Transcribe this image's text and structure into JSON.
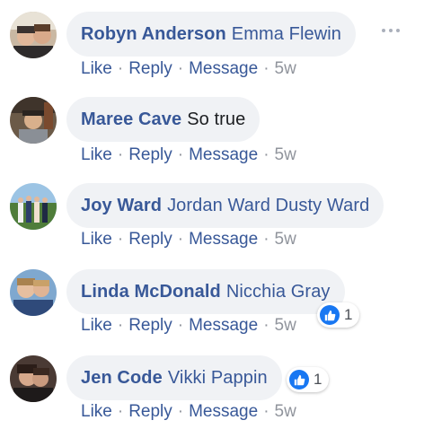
{
  "actions": {
    "like": "Like",
    "reply": "Reply",
    "message": "Message",
    "separator": "·"
  },
  "colors": {
    "author": "#385898",
    "bubble": "#f0f2f5",
    "meta": "#90949c",
    "like_blue": "#1877f2"
  },
  "comments": [
    {
      "author": "Robyn Anderson",
      "text": "Emma Flewin",
      "time": "5w",
      "avatar_icon": "profile-photo",
      "menu_icon": "ellipsis-icon"
    },
    {
      "author": "Maree Cave",
      "text": "So true",
      "time": "5w",
      "avatar_icon": "profile-photo"
    },
    {
      "author": "Joy Ward",
      "text": "Jordan Ward Dusty Ward",
      "time": "5w",
      "avatar_icon": "profile-photo"
    },
    {
      "author": "Linda McDonald",
      "text": "Nicchia Gray",
      "time": "5w",
      "avatar_icon": "profile-photo",
      "reaction_count": "1",
      "reaction_icon": "like-icon"
    },
    {
      "author": "Jen Code",
      "text": "Vikki Pappin",
      "time": "5w",
      "avatar_icon": "profile-photo",
      "reaction_count": "1",
      "reaction_icon": "like-icon"
    }
  ]
}
